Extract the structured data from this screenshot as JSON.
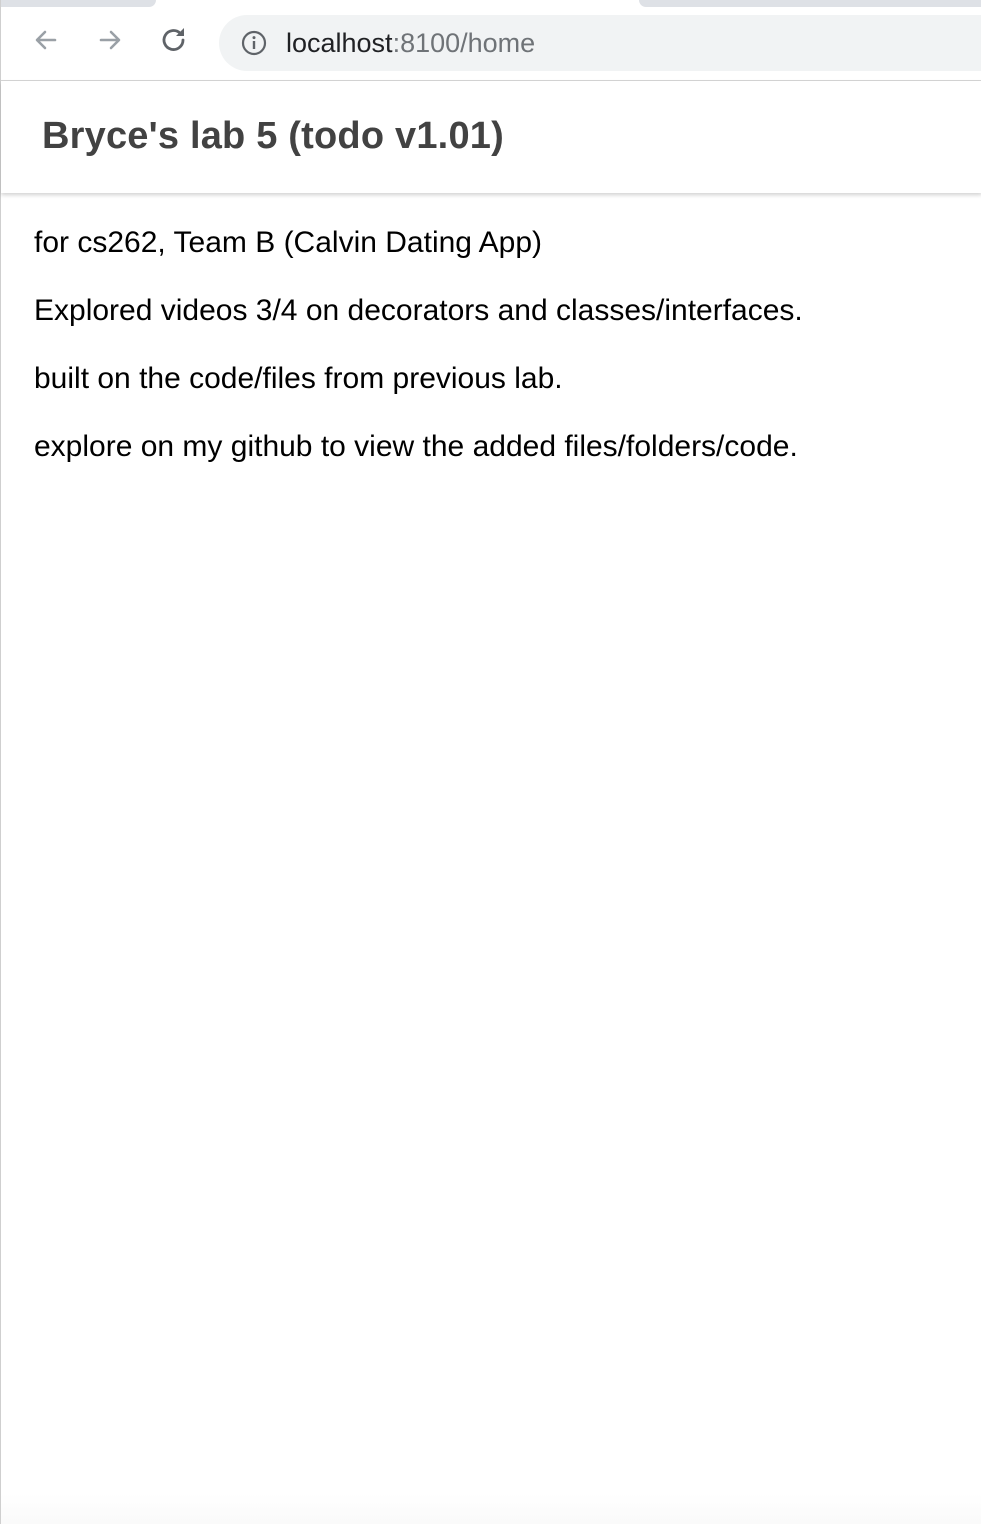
{
  "browser": {
    "url_host": "localhost",
    "url_path": ":8100/home",
    "icons": {
      "back": "arrow-left-icon",
      "forward": "arrow-right-icon",
      "reload": "reload-icon",
      "site_info": "info-icon"
    }
  },
  "app": {
    "title": "Bryce's lab 5 (todo v1.01)"
  },
  "content": {
    "paragraphs": [
      "for cs262, Team B (Calvin Dating App)",
      "Explored videos 3/4 on decorators and classes/interfaces.",
      "built on the code/files from previous lab.",
      "explore on my github to view the added files/folders/code."
    ]
  },
  "colors": {
    "title_text": "#424242",
    "body_text": "#000000",
    "omnibox_bg": "#f1f3f4",
    "url_path": "#6f7377"
  }
}
